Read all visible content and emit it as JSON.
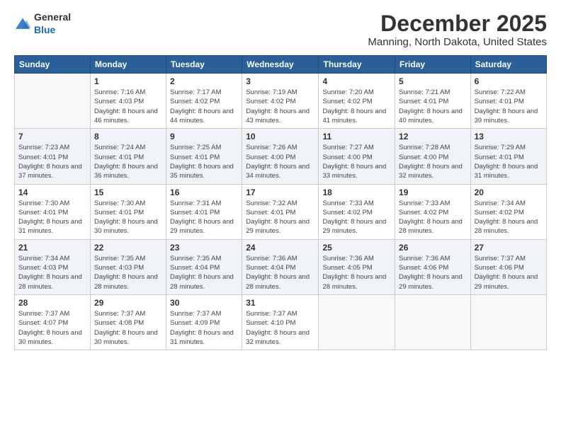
{
  "header": {
    "logo": {
      "general": "General",
      "blue": "Blue"
    },
    "title": "December 2025",
    "subtitle": "Manning, North Dakota, United States"
  },
  "weekdays": [
    "Sunday",
    "Monday",
    "Tuesday",
    "Wednesday",
    "Thursday",
    "Friday",
    "Saturday"
  ],
  "weeks": [
    [
      {
        "day": "",
        "sunrise": "",
        "sunset": "",
        "daylight": ""
      },
      {
        "day": "1",
        "sunrise": "Sunrise: 7:16 AM",
        "sunset": "Sunset: 4:03 PM",
        "daylight": "Daylight: 8 hours and 46 minutes."
      },
      {
        "day": "2",
        "sunrise": "Sunrise: 7:17 AM",
        "sunset": "Sunset: 4:02 PM",
        "daylight": "Daylight: 8 hours and 44 minutes."
      },
      {
        "day": "3",
        "sunrise": "Sunrise: 7:19 AM",
        "sunset": "Sunset: 4:02 PM",
        "daylight": "Daylight: 8 hours and 43 minutes."
      },
      {
        "day": "4",
        "sunrise": "Sunrise: 7:20 AM",
        "sunset": "Sunset: 4:02 PM",
        "daylight": "Daylight: 8 hours and 41 minutes."
      },
      {
        "day": "5",
        "sunrise": "Sunrise: 7:21 AM",
        "sunset": "Sunset: 4:01 PM",
        "daylight": "Daylight: 8 hours and 40 minutes."
      },
      {
        "day": "6",
        "sunrise": "Sunrise: 7:22 AM",
        "sunset": "Sunset: 4:01 PM",
        "daylight": "Daylight: 8 hours and 39 minutes."
      }
    ],
    [
      {
        "day": "7",
        "sunrise": "Sunrise: 7:23 AM",
        "sunset": "Sunset: 4:01 PM",
        "daylight": "Daylight: 8 hours and 37 minutes."
      },
      {
        "day": "8",
        "sunrise": "Sunrise: 7:24 AM",
        "sunset": "Sunset: 4:01 PM",
        "daylight": "Daylight: 8 hours and 36 minutes."
      },
      {
        "day": "9",
        "sunrise": "Sunrise: 7:25 AM",
        "sunset": "Sunset: 4:01 PM",
        "daylight": "Daylight: 8 hours and 35 minutes."
      },
      {
        "day": "10",
        "sunrise": "Sunrise: 7:26 AM",
        "sunset": "Sunset: 4:00 PM",
        "daylight": "Daylight: 8 hours and 34 minutes."
      },
      {
        "day": "11",
        "sunrise": "Sunrise: 7:27 AM",
        "sunset": "Sunset: 4:00 PM",
        "daylight": "Daylight: 8 hours and 33 minutes."
      },
      {
        "day": "12",
        "sunrise": "Sunrise: 7:28 AM",
        "sunset": "Sunset: 4:00 PM",
        "daylight": "Daylight: 8 hours and 32 minutes."
      },
      {
        "day": "13",
        "sunrise": "Sunrise: 7:29 AM",
        "sunset": "Sunset: 4:01 PM",
        "daylight": "Daylight: 8 hours and 31 minutes."
      }
    ],
    [
      {
        "day": "14",
        "sunrise": "Sunrise: 7:30 AM",
        "sunset": "Sunset: 4:01 PM",
        "daylight": "Daylight: 8 hours and 31 minutes."
      },
      {
        "day": "15",
        "sunrise": "Sunrise: 7:30 AM",
        "sunset": "Sunset: 4:01 PM",
        "daylight": "Daylight: 8 hours and 30 minutes."
      },
      {
        "day": "16",
        "sunrise": "Sunrise: 7:31 AM",
        "sunset": "Sunset: 4:01 PM",
        "daylight": "Daylight: 8 hours and 29 minutes."
      },
      {
        "day": "17",
        "sunrise": "Sunrise: 7:32 AM",
        "sunset": "Sunset: 4:01 PM",
        "daylight": "Daylight: 8 hours and 29 minutes."
      },
      {
        "day": "18",
        "sunrise": "Sunrise: 7:33 AM",
        "sunset": "Sunset: 4:02 PM",
        "daylight": "Daylight: 8 hours and 29 minutes."
      },
      {
        "day": "19",
        "sunrise": "Sunrise: 7:33 AM",
        "sunset": "Sunset: 4:02 PM",
        "daylight": "Daylight: 8 hours and 28 minutes."
      },
      {
        "day": "20",
        "sunrise": "Sunrise: 7:34 AM",
        "sunset": "Sunset: 4:02 PM",
        "daylight": "Daylight: 8 hours and 28 minutes."
      }
    ],
    [
      {
        "day": "21",
        "sunrise": "Sunrise: 7:34 AM",
        "sunset": "Sunset: 4:03 PM",
        "daylight": "Daylight: 8 hours and 28 minutes."
      },
      {
        "day": "22",
        "sunrise": "Sunrise: 7:35 AM",
        "sunset": "Sunset: 4:03 PM",
        "daylight": "Daylight: 8 hours and 28 minutes."
      },
      {
        "day": "23",
        "sunrise": "Sunrise: 7:35 AM",
        "sunset": "Sunset: 4:04 PM",
        "daylight": "Daylight: 8 hours and 28 minutes."
      },
      {
        "day": "24",
        "sunrise": "Sunrise: 7:36 AM",
        "sunset": "Sunset: 4:04 PM",
        "daylight": "Daylight: 8 hours and 28 minutes."
      },
      {
        "day": "25",
        "sunrise": "Sunrise: 7:36 AM",
        "sunset": "Sunset: 4:05 PM",
        "daylight": "Daylight: 8 hours and 28 minutes."
      },
      {
        "day": "26",
        "sunrise": "Sunrise: 7:36 AM",
        "sunset": "Sunset: 4:06 PM",
        "daylight": "Daylight: 8 hours and 29 minutes."
      },
      {
        "day": "27",
        "sunrise": "Sunrise: 7:37 AM",
        "sunset": "Sunset: 4:06 PM",
        "daylight": "Daylight: 8 hours and 29 minutes."
      }
    ],
    [
      {
        "day": "28",
        "sunrise": "Sunrise: 7:37 AM",
        "sunset": "Sunset: 4:07 PM",
        "daylight": "Daylight: 8 hours and 30 minutes."
      },
      {
        "day": "29",
        "sunrise": "Sunrise: 7:37 AM",
        "sunset": "Sunset: 4:08 PM",
        "daylight": "Daylight: 8 hours and 30 minutes."
      },
      {
        "day": "30",
        "sunrise": "Sunrise: 7:37 AM",
        "sunset": "Sunset: 4:09 PM",
        "daylight": "Daylight: 8 hours and 31 minutes."
      },
      {
        "day": "31",
        "sunrise": "Sunrise: 7:37 AM",
        "sunset": "Sunset: 4:10 PM",
        "daylight": "Daylight: 8 hours and 32 minutes."
      },
      {
        "day": "",
        "sunrise": "",
        "sunset": "",
        "daylight": ""
      },
      {
        "day": "",
        "sunrise": "",
        "sunset": "",
        "daylight": ""
      },
      {
        "day": "",
        "sunrise": "",
        "sunset": "",
        "daylight": ""
      }
    ]
  ]
}
